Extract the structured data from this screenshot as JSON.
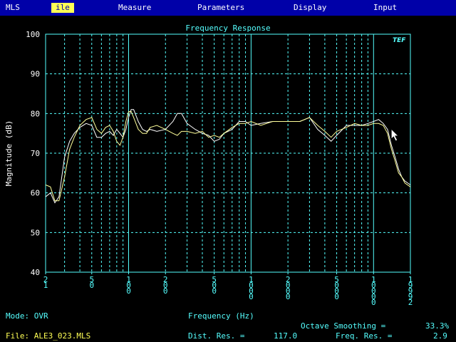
{
  "menu": {
    "items": [
      {
        "label": "MLS",
        "active": false
      },
      {
        "label": "ile",
        "active": true
      },
      {
        "label": "Measure",
        "active": false
      },
      {
        "label": "Parameters",
        "active": false
      },
      {
        "label": "Display",
        "active": false
      },
      {
        "label": "Input",
        "active": false
      }
    ]
  },
  "colors": {
    "background": "#000000",
    "menubar": "#0000a8",
    "grid": "#55ffff",
    "label": "#55ffff",
    "trace_white": "#ffffff",
    "trace_yellow": "#ffff99",
    "file_text": "#ffff55"
  },
  "logo_text": "TEF",
  "chart_data": {
    "type": "line",
    "title": "Frequency Response",
    "xlabel": "Frequency (Hz)",
    "ylabel": "Magnitude (dB)",
    "xscale": "log",
    "xlim": [
      21,
      19992
    ],
    "ylim": [
      40,
      100
    ],
    "yticks": [
      40,
      50,
      60,
      70,
      80,
      90,
      100
    ],
    "xtick_labels": [
      {
        "value": 21,
        "label": "21"
      },
      {
        "value": 50,
        "label": "50"
      },
      {
        "value": 100,
        "label": "100"
      },
      {
        "value": 200,
        "label": "200"
      },
      {
        "value": 500,
        "label": "500"
      },
      {
        "value": 1000,
        "label": "1000"
      },
      {
        "value": 2000,
        "label": "2000"
      },
      {
        "value": 5000,
        "label": "5000"
      },
      {
        "value": 10000,
        "label": "10000"
      },
      {
        "value": 19992,
        "label": "19992"
      }
    ],
    "grid_major": [
      100,
      1000,
      10000
    ],
    "grid_minor": [
      30,
      40,
      50,
      60,
      70,
      80,
      90,
      200,
      300,
      400,
      500,
      600,
      700,
      800,
      900,
      2000,
      3000,
      4000,
      5000,
      6000,
      7000,
      8000,
      9000
    ],
    "grid": true,
    "series": [
      {
        "color": "#ffffff",
        "points": [
          [
            21,
            59
          ],
          [
            23,
            60
          ],
          [
            25,
            57.5
          ],
          [
            27,
            59
          ],
          [
            30,
            69
          ],
          [
            33,
            73
          ],
          [
            36,
            75
          ],
          [
            40,
            76.5
          ],
          [
            45,
            77.5
          ],
          [
            50,
            77
          ],
          [
            55,
            74
          ],
          [
            60,
            74
          ],
          [
            65,
            75
          ],
          [
            70,
            75.5
          ],
          [
            75,
            74.5
          ],
          [
            80,
            76
          ],
          [
            85,
            75
          ],
          [
            90,
            74
          ],
          [
            95,
            76
          ],
          [
            100,
            79
          ],
          [
            105,
            81
          ],
          [
            110,
            81
          ],
          [
            120,
            78
          ],
          [
            130,
            76
          ],
          [
            140,
            75.5
          ],
          [
            150,
            76
          ],
          [
            170,
            75.5
          ],
          [
            200,
            76
          ],
          [
            230,
            78
          ],
          [
            250,
            80
          ],
          [
            270,
            80
          ],
          [
            300,
            77.5
          ],
          [
            350,
            76
          ],
          [
            400,
            75
          ],
          [
            450,
            74.5
          ],
          [
            500,
            73
          ],
          [
            550,
            73.5
          ],
          [
            600,
            75
          ],
          [
            700,
            76
          ],
          [
            800,
            78
          ],
          [
            900,
            78
          ],
          [
            1000,
            77
          ],
          [
            1200,
            77.5
          ],
          [
            1500,
            78
          ],
          [
            2000,
            78
          ],
          [
            2500,
            78
          ],
          [
            3000,
            79
          ],
          [
            3500,
            76
          ],
          [
            4000,
            74.5
          ],
          [
            4500,
            73
          ],
          [
            5000,
            74.5
          ],
          [
            6000,
            77
          ],
          [
            7000,
            77
          ],
          [
            8000,
            77
          ],
          [
            9000,
            77.5
          ],
          [
            10000,
            78
          ],
          [
            11000,
            78.5
          ],
          [
            12000,
            77.5
          ],
          [
            13000,
            76
          ],
          [
            14000,
            72
          ],
          [
            15000,
            69
          ],
          [
            16000,
            66
          ],
          [
            17000,
            64
          ],
          [
            18000,
            63
          ],
          [
            19992,
            62
          ]
        ]
      },
      {
        "color": "#ffff99",
        "points": [
          [
            21,
            62
          ],
          [
            23,
            61.5
          ],
          [
            25,
            58
          ],
          [
            27,
            58
          ],
          [
            30,
            64
          ],
          [
            33,
            71
          ],
          [
            36,
            74
          ],
          [
            40,
            77
          ],
          [
            45,
            78.5
          ],
          [
            50,
            79
          ],
          [
            55,
            76
          ],
          [
            60,
            75
          ],
          [
            65,
            76.5
          ],
          [
            70,
            77
          ],
          [
            75,
            75.5
          ],
          [
            80,
            73
          ],
          [
            85,
            72
          ],
          [
            90,
            74
          ],
          [
            95,
            78
          ],
          [
            100,
            80.5
          ],
          [
            105,
            80.5
          ],
          [
            110,
            79
          ],
          [
            120,
            76
          ],
          [
            130,
            75
          ],
          [
            140,
            75
          ],
          [
            150,
            76.5
          ],
          [
            170,
            77
          ],
          [
            200,
            76
          ],
          [
            230,
            75
          ],
          [
            250,
            74.5
          ],
          [
            270,
            75.5
          ],
          [
            300,
            75.5
          ],
          [
            350,
            75
          ],
          [
            400,
            75.5
          ],
          [
            450,
            74
          ],
          [
            500,
            74.5
          ],
          [
            550,
            74
          ],
          [
            600,
            75
          ],
          [
            700,
            76.5
          ],
          [
            800,
            77.5
          ],
          [
            900,
            77.5
          ],
          [
            1000,
            78
          ],
          [
            1200,
            77
          ],
          [
            1500,
            78
          ],
          [
            2000,
            78
          ],
          [
            2500,
            78
          ],
          [
            3000,
            79
          ],
          [
            3500,
            77
          ],
          [
            4000,
            75.5
          ],
          [
            4500,
            74
          ],
          [
            5000,
            75.5
          ],
          [
            6000,
            76.5
          ],
          [
            7000,
            77.5
          ],
          [
            8000,
            77
          ],
          [
            9000,
            77
          ],
          [
            10000,
            77.5
          ],
          [
            11000,
            77.5
          ],
          [
            12000,
            77
          ],
          [
            13000,
            75
          ],
          [
            14000,
            71
          ],
          [
            15000,
            68
          ],
          [
            16000,
            65
          ],
          [
            17000,
            64
          ],
          [
            18000,
            62.5
          ],
          [
            19992,
            61.5
          ]
        ]
      }
    ]
  },
  "status": {
    "mode_label": "Mode: OVR",
    "file_label": "File: ALE3_023.MLS",
    "xaxis_caption": "Frequency (Hz)",
    "octave_smoothing_label": "Octave Smoothing =",
    "octave_smoothing_value": "33.3%",
    "dist_res_label": "Dist. Res. =",
    "dist_res_value": "117.0",
    "freq_res_label": "Freq. Res. =",
    "freq_res_value": "2.9"
  },
  "cursor": {
    "visible": true,
    "frequency_hz": 14000,
    "magnitude_db": 76
  }
}
